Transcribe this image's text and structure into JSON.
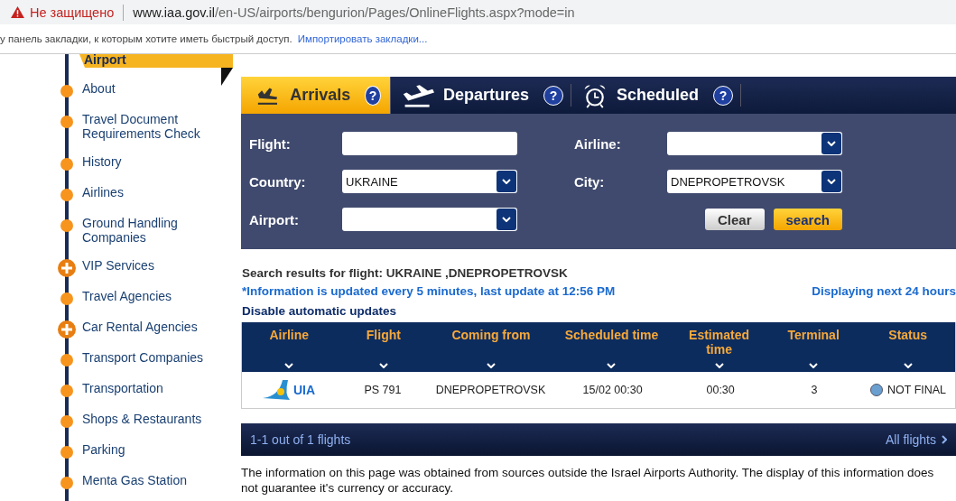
{
  "browser": {
    "security": "Не защищено",
    "url_host": "www.iaa.gov.il",
    "url_path": "/en-US/airports/bengurion/Pages/OnlineFlights.aspx?mode=in",
    "bookmarks_hint": "у панель закладки, к которым хотите иметь быстрый доступ.",
    "bookmarks_link": "Импортировать закладки..."
  },
  "sidebar": {
    "title": "Airport",
    "items": [
      {
        "label": "About",
        "kind": "dot"
      },
      {
        "label": "Travel Document Requirements Check",
        "kind": "dot"
      },
      {
        "label": "History",
        "kind": "dot"
      },
      {
        "label": "Airlines",
        "kind": "dot"
      },
      {
        "label": "Ground Handling Companies",
        "kind": "dot"
      },
      {
        "label": "VIP Services",
        "kind": "plus"
      },
      {
        "label": "Travel Agencies",
        "kind": "dot"
      },
      {
        "label": "Car Rental Agencies",
        "kind": "plus"
      },
      {
        "label": "Transport Companies",
        "kind": "dot"
      },
      {
        "label": "Transportation",
        "kind": "dot"
      },
      {
        "label": "Shops & Restaurants",
        "kind": "dot"
      },
      {
        "label": "Parking",
        "kind": "dot"
      },
      {
        "label": "Menta Gas Station",
        "kind": "dot"
      }
    ]
  },
  "tabs": [
    {
      "label": "Arrivals",
      "kind": "arrivals",
      "selected": true,
      "help": "?"
    },
    {
      "label": "Departures",
      "kind": "departures",
      "selected": false,
      "help": "?"
    },
    {
      "label": "Scheduled",
      "kind": "scheduled",
      "selected": false,
      "help": "?"
    }
  ],
  "form": {
    "fields": [
      {
        "label": "Flight:",
        "kind": "text"
      },
      {
        "label": "Airline:",
        "kind": "select"
      },
      {
        "label": "Country:",
        "kind": "select",
        "value": "UKRAINE"
      },
      {
        "label": "City:",
        "kind": "select",
        "value": "DNEPROPETROVSK"
      },
      {
        "label": "Airport:",
        "kind": "select"
      }
    ],
    "buttons": [
      {
        "label": "Clear",
        "kind": "secondary"
      },
      {
        "label": "search",
        "kind": "primary"
      }
    ]
  },
  "results": {
    "title": "Search results for flight: UKRAINE ,DNEPROPETROVSK",
    "update_note": "*Information is updated every 5 minutes, last update at 12:56 PM",
    "range_note": "Displaying next 24 hours",
    "disable_link": "Disable automatic updates"
  },
  "table": {
    "columns": [
      "Airline",
      "Flight",
      "Coming from",
      "Scheduled time",
      "Estimated time",
      "Terminal",
      "Status"
    ],
    "rows": [
      {
        "airline": "UIA",
        "flight": "PS 791",
        "from": "DNEPROPETROVSK",
        "scheduled": "15/02 00:30",
        "estimated": "00:30",
        "terminal": "3",
        "status": "NOT FINAL"
      }
    ]
  },
  "pager": {
    "count": "1-1 out of 1 flights",
    "all_link": "All flights"
  },
  "disclaimer": "The information on this page was obtained from sources outside the Israel Airports Authority. The display of this information does not guarantee it's currency or accuracy."
}
